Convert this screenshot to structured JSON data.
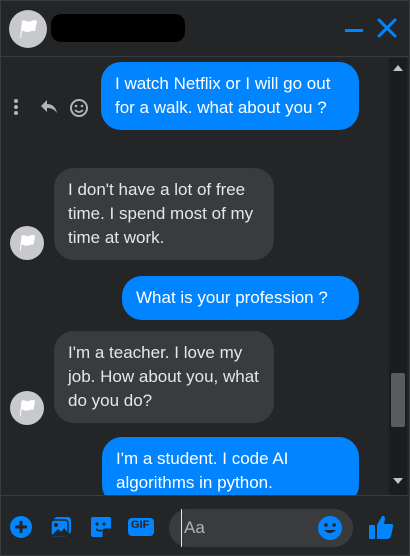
{
  "header": {
    "contact_name": "",
    "minimize_icon": "minimize-icon",
    "close_icon": "close-icon"
  },
  "messages": [
    {
      "direction": "out",
      "text": "I watch Netflix or I will go out for a walk. what about you ?"
    },
    {
      "direction": "in",
      "text": "I don't have a lot of free time. I spend most of my time at work."
    },
    {
      "direction": "out",
      "text": "What is your profession ?"
    },
    {
      "direction": "in",
      "text": "I'm a teacher. I love my job. How about you, what do you do?"
    },
    {
      "direction": "out",
      "text": "I'm a student. I code AI algorithms in python."
    }
  ],
  "composer": {
    "placeholder": "Aa",
    "gif_label": "GIF"
  },
  "colors": {
    "accent": "#0084ff",
    "background": "#242526",
    "incoming_bubble": "#3a3b3c"
  }
}
